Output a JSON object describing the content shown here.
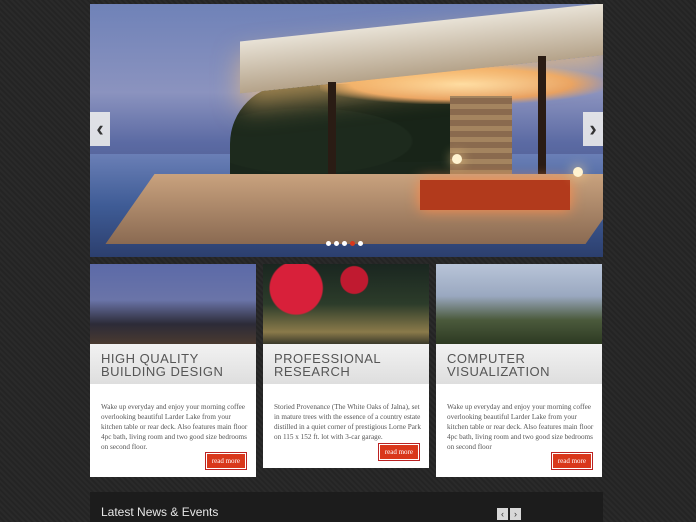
{
  "slider": {
    "prev_icon": "‹",
    "next_icon": "›",
    "dots": 5,
    "active_dot": 3,
    "accent": "#d9371b"
  },
  "cards": [
    {
      "title": "HIGH QUALITY\nBUILDING DESIGN",
      "description": "Wake up everyday and enjoy your morning coffee overlooking beautiful Larder Lake from your kitchen table or rear deck. Also features main floor 4pc bath, living room and two good size bedrooms on second floor.",
      "more": "read more"
    },
    {
      "title": "PROFESSIONAL\nRESEARCH",
      "description": "Storied Provenance (The White Oaks of Jalna), set in mature trees with the essence of a country estate distilled in a quiet corner of prestigious Lorne Park on 115 x 152 ft. lot with 3-car garage.",
      "more": "read more"
    },
    {
      "title": "COMPUTER\nVISUALIZATION",
      "description": "Wake up everyday and enjoy your morning coffee overlooking beautiful Larder Lake from your kitchen table or rear deck. Also features main floor 4pc bath, living room and two good size bedrooms on second floor",
      "more": "read more"
    }
  ],
  "news": {
    "title": "Latest News & Events",
    "prev_icon": "‹",
    "next_icon": "›"
  }
}
